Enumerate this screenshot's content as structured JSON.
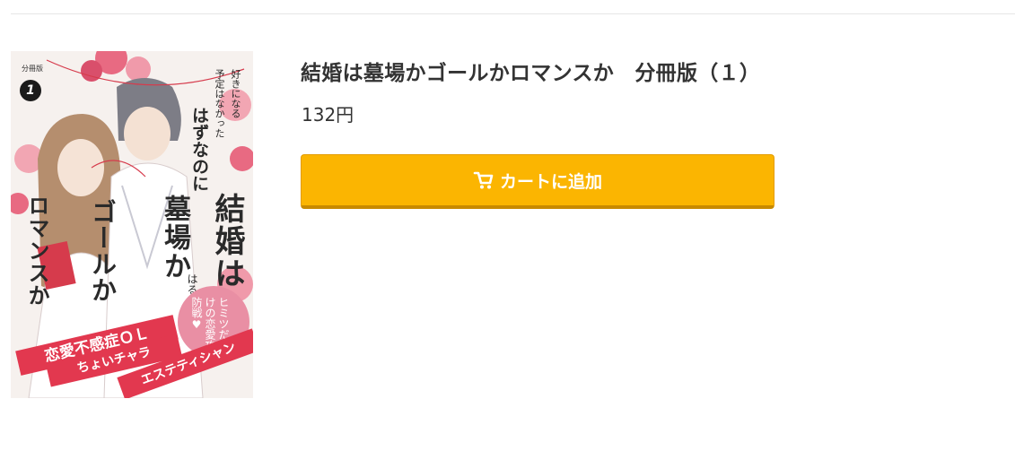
{
  "product": {
    "title": "結婚は墓場かゴールかロマンスか　分冊版（１）",
    "price": "132円"
  },
  "cart_button": {
    "label": "カートに追加",
    "icon": "cart-icon",
    "color": "#fbb501"
  },
  "cover": {
    "volume_label": "分冊版",
    "volume_number": "1",
    "title_line_1": "結婚は",
    "title_line_2": "墓場か",
    "title_line_3": "ゴールか",
    "title_line_4": "ロマンスか",
    "tagline_1": "好きになる",
    "tagline_2": "予定はなかった",
    "tagline_3": "はずなのに",
    "author": "はるこ",
    "bubble_text": "ヒミツだらけの恋愛攻防戦♥",
    "band_1": "恋愛不感症ＯＬ",
    "band_2": "ちょいチャラ",
    "band_3": "エステティシャン"
  }
}
